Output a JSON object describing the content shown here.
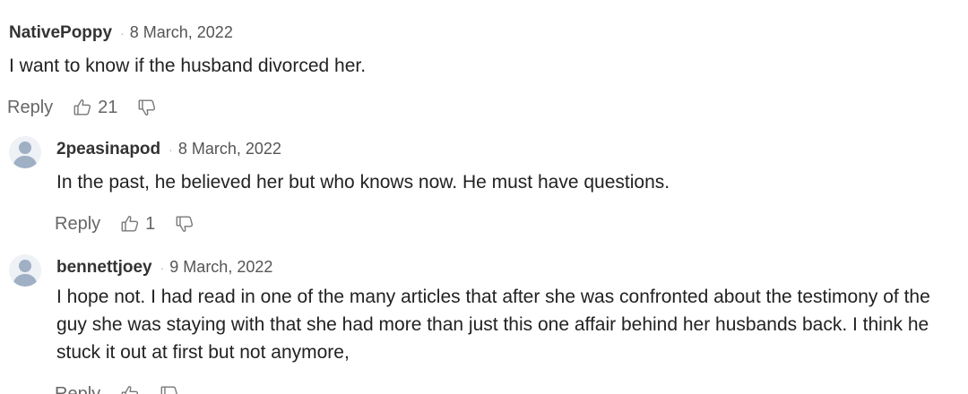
{
  "comments": [
    {
      "author": "NativePoppy",
      "separator": "·",
      "date": "8 March, 2022",
      "text": "I want to know if the husband divorced her.",
      "reply_label": "Reply",
      "likes": "21"
    },
    {
      "author": "2peasinapod",
      "separator": "·",
      "date": "8 March, 2022",
      "text": "In the past, he believed her but who knows now.  He must have questions.",
      "reply_label": "Reply",
      "likes": "1"
    },
    {
      "author": "bennettjoey",
      "separator": "·",
      "date": "9 March, 2022",
      "text": "I hope not.  I had read in one of the many articles that after she was confronted about the testimony of the guy she was staying with that she had more than just this one affair behind her husbands back.  I think he stuck it out at first but not anymore,",
      "reply_label": "Reply"
    }
  ],
  "icons": {
    "avatar": "default-user-avatar-icon",
    "like": "thumbs-up-icon",
    "dislike": "thumbs-down-icon"
  },
  "colors": {
    "avatar_silhouette": "#9fb0c5",
    "text": "#222222",
    "muted": "#666666"
  }
}
